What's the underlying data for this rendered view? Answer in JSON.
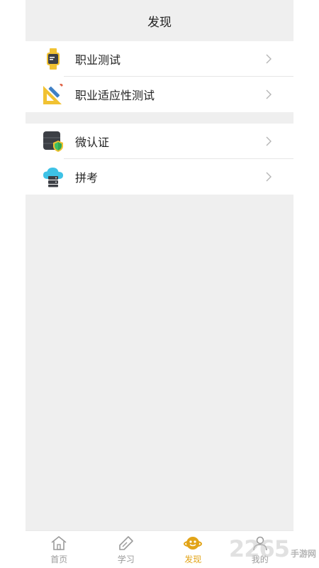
{
  "header": {
    "title": "发现"
  },
  "groups": [
    {
      "items": [
        {
          "label": "职业测试",
          "icon": "smartwatch-icon"
        },
        {
          "label": "职业适应性测试",
          "icon": "ruler-pencil-icon"
        }
      ]
    },
    {
      "items": [
        {
          "label": "微认证",
          "icon": "database-shield-icon"
        },
        {
          "label": "拼考",
          "icon": "cloud-server-icon"
        }
      ]
    }
  ],
  "tabbar": {
    "tabs": [
      {
        "label": "首页",
        "icon": "home-icon",
        "active": false
      },
      {
        "label": "学习",
        "icon": "pen-icon",
        "active": false
      },
      {
        "label": "发现",
        "icon": "discover-icon",
        "active": true
      },
      {
        "label": "我的",
        "icon": "user-icon",
        "active": false
      }
    ]
  },
  "watermark": {
    "number": "2265",
    "text": "手游网"
  },
  "colors": {
    "accent": "#e2a418",
    "background": "#efefef",
    "inactive": "#9b9b9b"
  }
}
